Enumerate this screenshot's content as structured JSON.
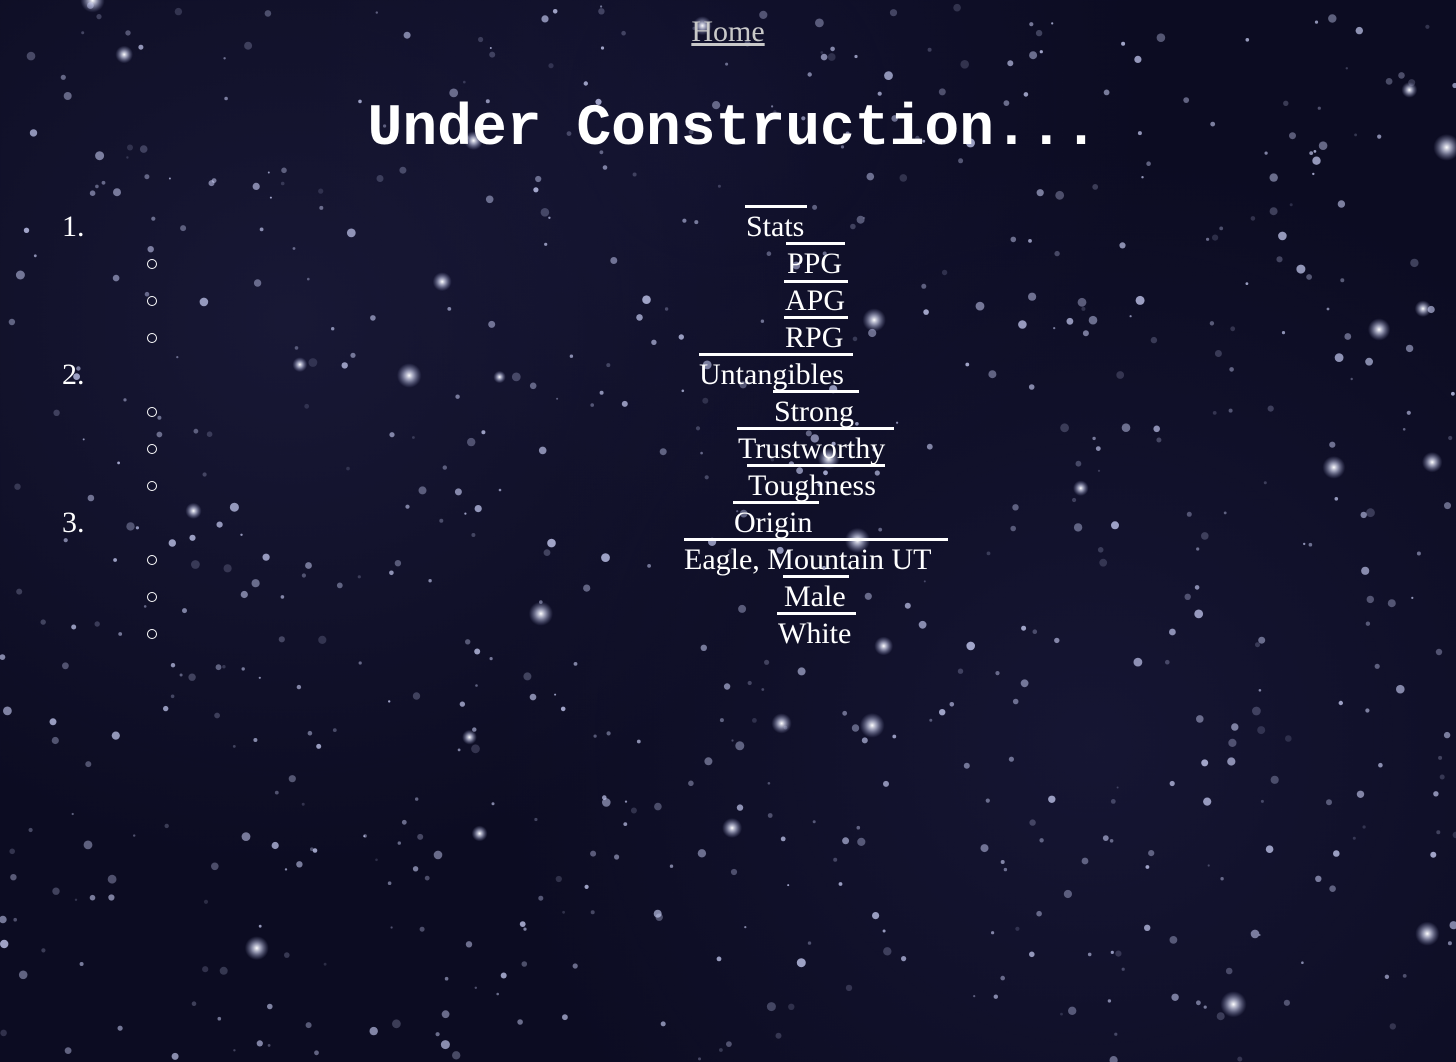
{
  "nav": {
    "home_label": "Home"
  },
  "title": "Under Construction...",
  "sections": [
    {
      "number": "1.",
      "label": "Stats",
      "items": [
        "PPG",
        "APG",
        "RPG"
      ]
    },
    {
      "number": "2.",
      "label": "Untangibles",
      "items": [
        "Strong",
        "Trustworthy",
        "Toughness"
      ]
    },
    {
      "number": "3.",
      "label": "Origin",
      "items": [
        "Eagle, Mountain UT",
        "Male",
        "White"
      ]
    }
  ]
}
